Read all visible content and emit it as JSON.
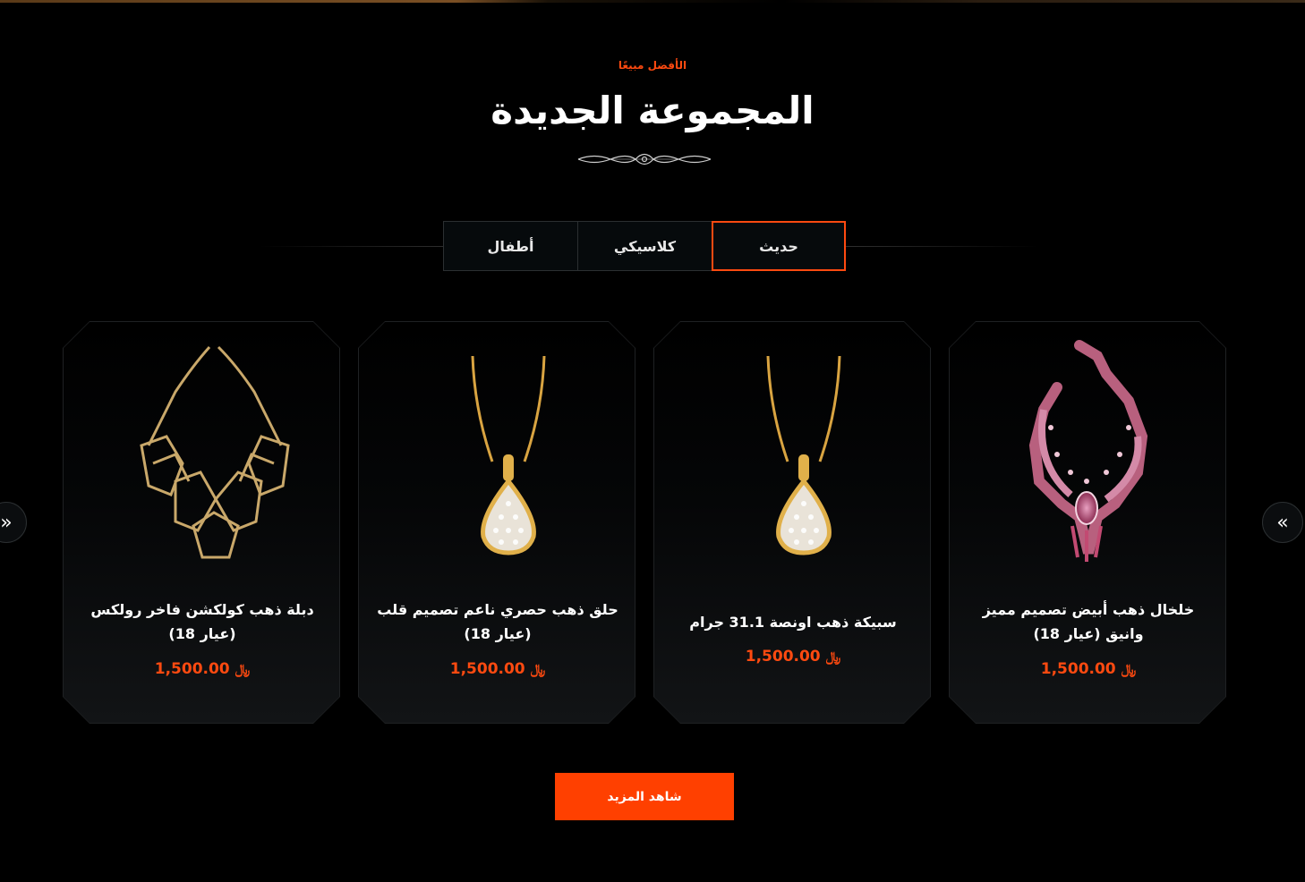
{
  "header": {
    "eyebrow": "الأفضل مبيعًا",
    "title": "المجموعة الجديدة"
  },
  "tabs": [
    {
      "label": "حديث",
      "active": true
    },
    {
      "label": "كلاسيكي",
      "active": false
    },
    {
      "label": "أطفال",
      "active": false
    }
  ],
  "products": [
    {
      "name": "خلخال ذهب أبيض تصميم مميز وانيق (عيار 18)",
      "price": "1,500.00",
      "currency_symbol": "﷼",
      "icon": "pink-gem-necklace-icon"
    },
    {
      "name": "سبيكة ذهب اونصة 31.1 جرام",
      "price": "1,500.00",
      "currency_symbol": "﷼",
      "icon": "diamond-pendant-icon"
    },
    {
      "name": "حلق ذهب حصري ناعم تصميم قلب (عيار 18)",
      "price": "1,500.00",
      "currency_symbol": "﷼",
      "icon": "diamond-pendant-icon"
    },
    {
      "name": "دبلة ذهب كولكشن فاخر رولكس (عيار 18)",
      "price": "1,500.00",
      "currency_symbol": "﷼",
      "icon": "gold-geometric-necklace-icon"
    }
  ],
  "navigation": {
    "prev_icon": "double-chevron-left-icon",
    "next_icon": "double-chevron-right-icon"
  },
  "cta": {
    "label": "شاهد المزيد"
  },
  "colors": {
    "accent": "#ff4a10",
    "button": "#ff4000",
    "background": "#000000",
    "text": "#ffffff"
  }
}
